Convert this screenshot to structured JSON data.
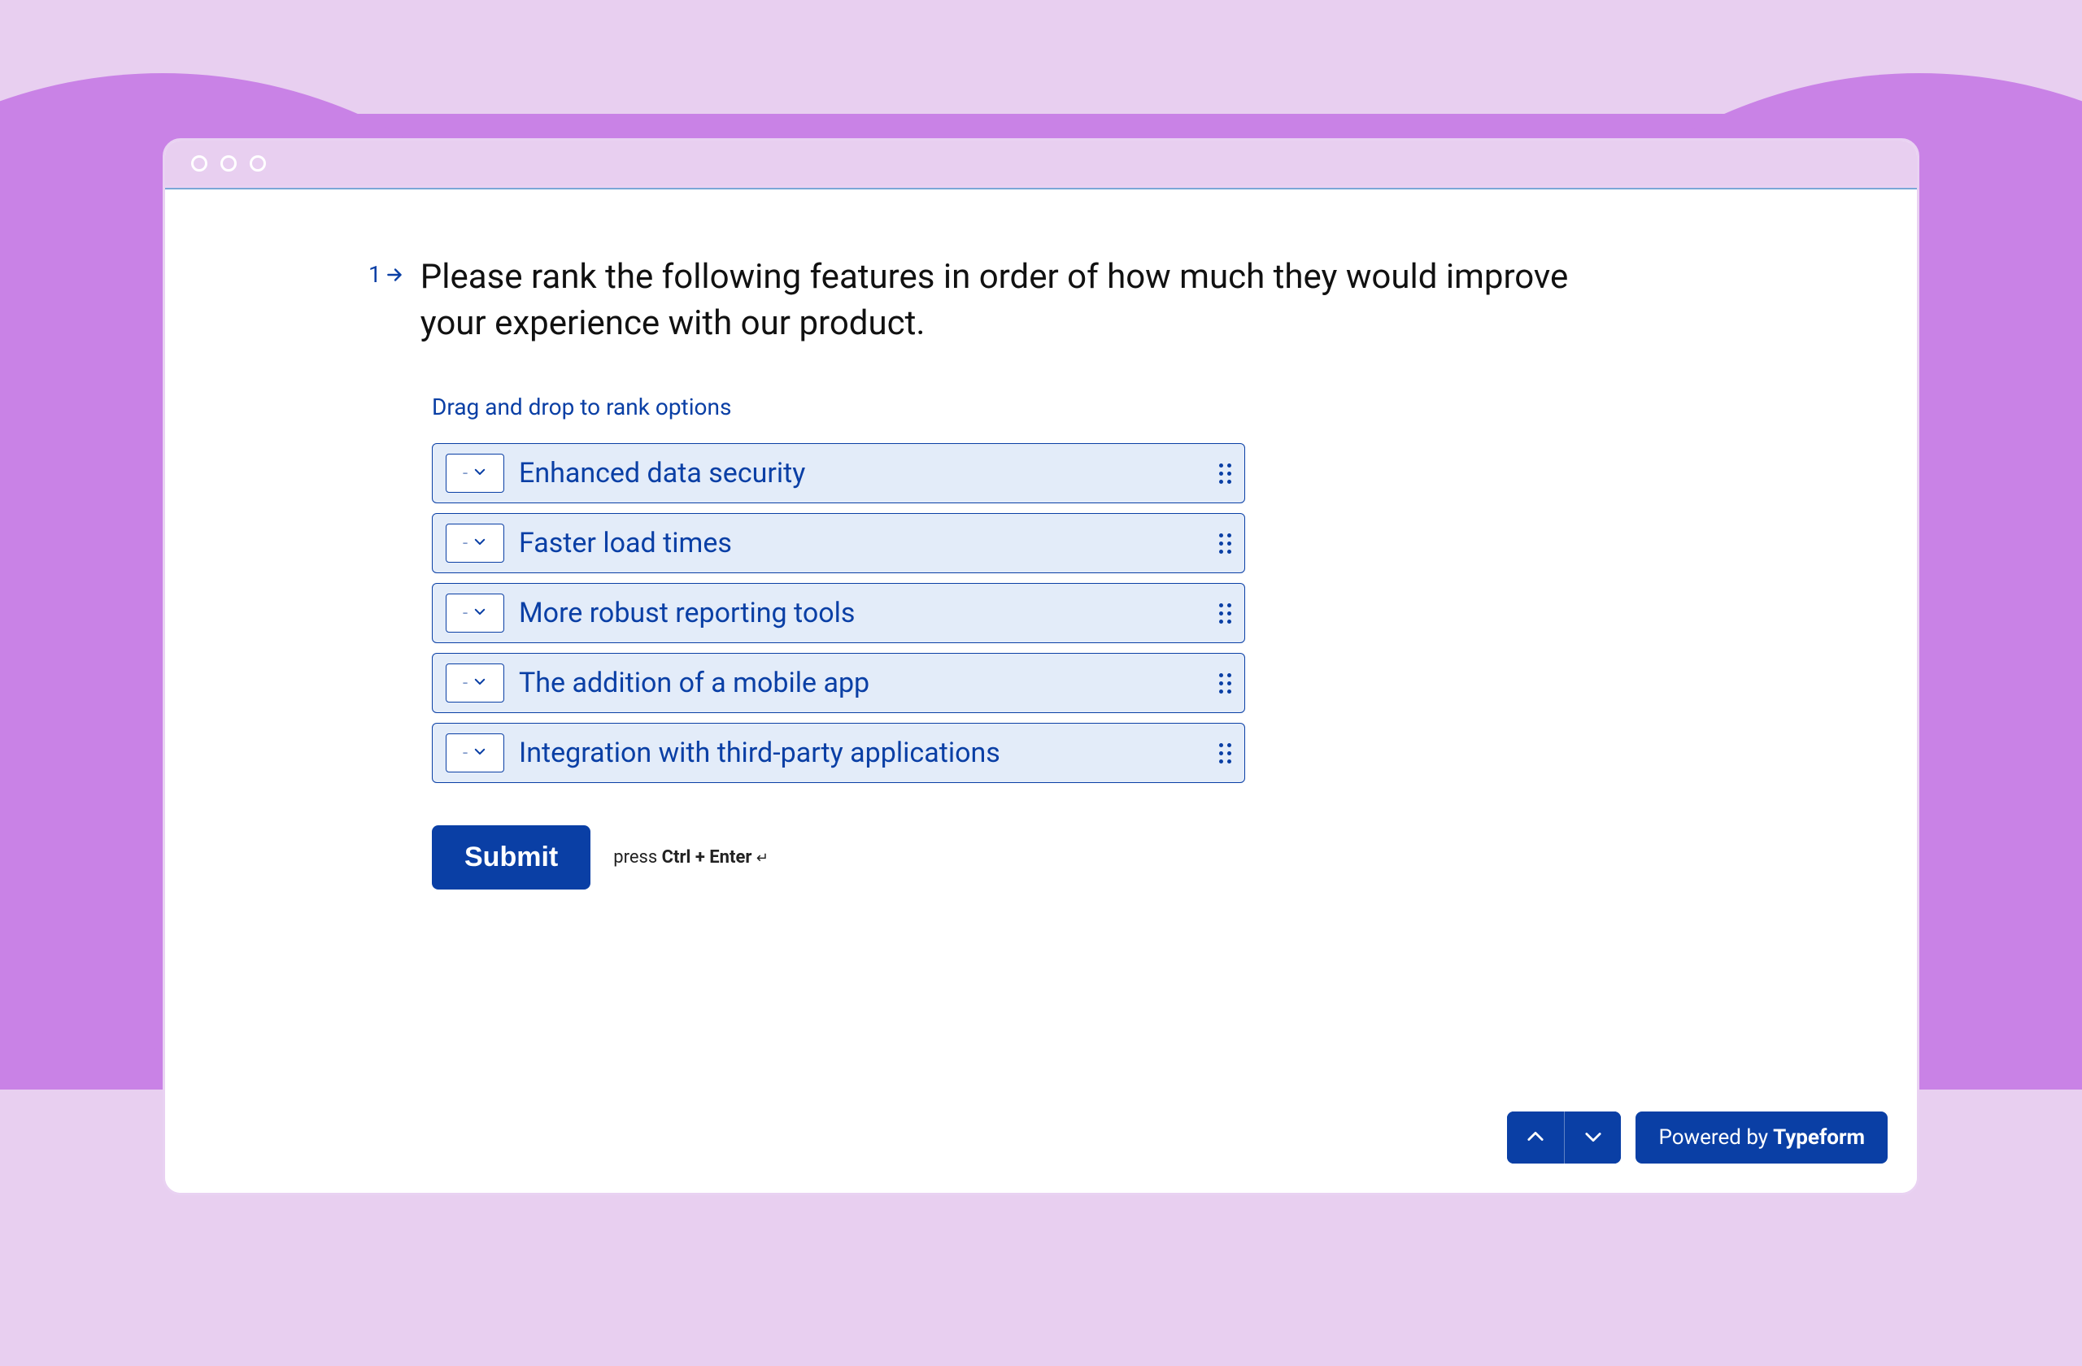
{
  "question": {
    "number": "1",
    "text": "Please rank the following features in order of how much they would improve your experience with our product.",
    "instruction": "Drag and drop to rank options"
  },
  "options": [
    {
      "rank_value": "-",
      "label": "Enhanced data security"
    },
    {
      "rank_value": "-",
      "label": "Faster load times"
    },
    {
      "rank_value": "-",
      "label": "More robust reporting tools"
    },
    {
      "rank_value": "-",
      "label": "The addition of a mobile app"
    },
    {
      "rank_value": "-",
      "label": "Integration with third-party applications"
    }
  ],
  "submit": {
    "button_label": "Submit",
    "hint_prefix": "press ",
    "hint_keys": "Ctrl + Enter"
  },
  "footer": {
    "powered_prefix": "Powered by ",
    "powered_brand": "Typeform"
  },
  "colors": {
    "accent": "#0a3fa5",
    "option_bg": "#e3ecf9",
    "page_bg": "#e8cff0",
    "blob": "#c982e6"
  }
}
